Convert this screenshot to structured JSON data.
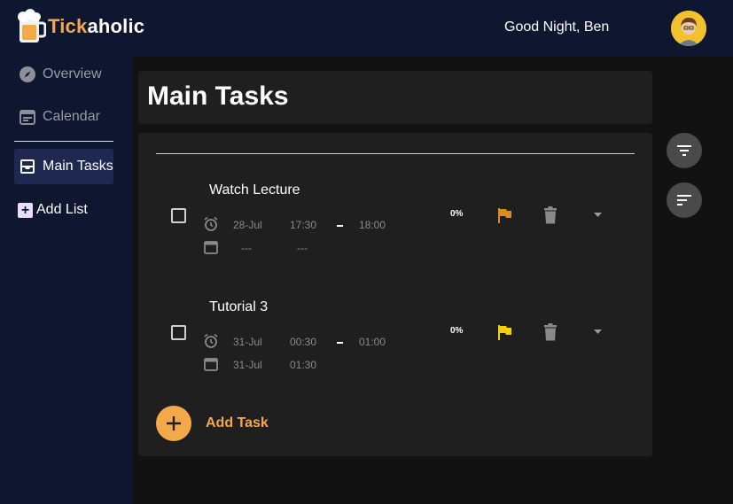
{
  "app": {
    "name_prefix": "Tick",
    "name_suffix": "aholic",
    "greeting": "Good Night, Ben",
    "brand_color": "#f4a84a",
    "topbar_color": "#0f1630"
  },
  "sidebar": {
    "items": [
      {
        "label": "Overview",
        "icon": "compass-icon"
      },
      {
        "label": "Calendar",
        "icon": "calendar-icon"
      },
      {
        "label": "Main Tasks",
        "icon": "inbox-icon",
        "active": true
      }
    ],
    "add_list_label": "Add List"
  },
  "main": {
    "title": "Main Tasks",
    "add_task_label": "Add Task",
    "tasks": [
      {
        "title": "Watch Lecture",
        "start_date": "28-Jul",
        "start_time": "17:30",
        "end_time": "18:00",
        "due_date": "---",
        "due_time": "---",
        "progress": "0%",
        "priority_color": "#e08a1e",
        "completed": false
      },
      {
        "title": "Tutorial 3",
        "start_date": "31-Jul",
        "start_time": "00:30",
        "end_time": "01:00",
        "due_date": "31-Jul",
        "due_time": "01:30",
        "progress": "0%",
        "priority_color": "#f5d000",
        "completed": false
      }
    ]
  }
}
